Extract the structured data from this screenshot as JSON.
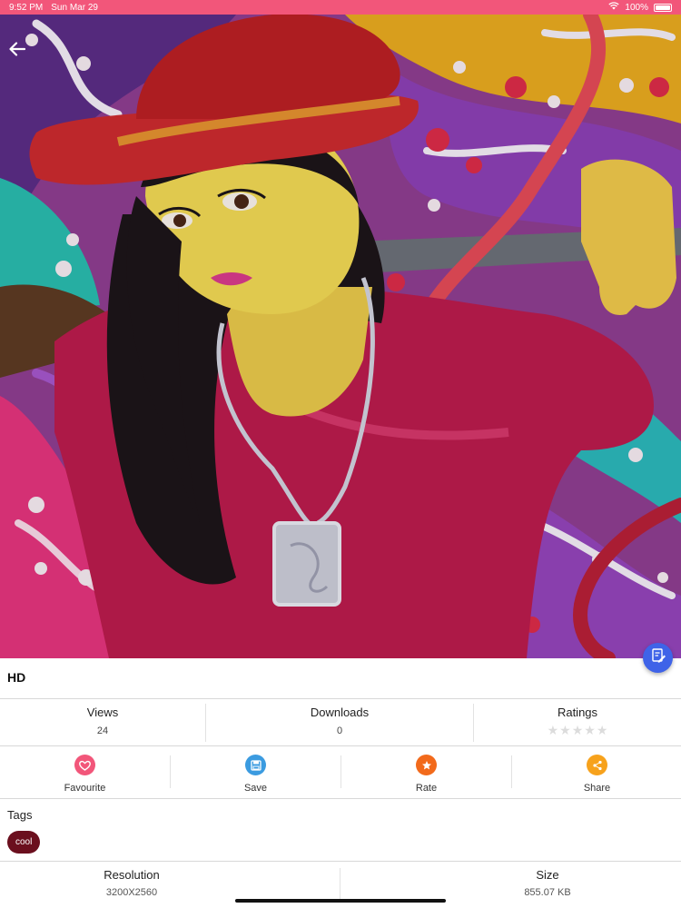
{
  "status_bar": {
    "time": "9:52 PM",
    "date": "Sun Mar 29",
    "battery": "100%",
    "icons": [
      "wifi-icon",
      "battery-icon"
    ]
  },
  "hero": {
    "icon": "back-arrow-icon",
    "fab_icon": "edit-document-icon",
    "fab_color": "#3f63e8"
  },
  "quality_label": "HD",
  "stats": {
    "views": {
      "label": "Views",
      "value": "24"
    },
    "downloads": {
      "label": "Downloads",
      "value": "0"
    },
    "ratings": {
      "label": "Ratings",
      "stars": 5,
      "filled": 0
    }
  },
  "actions": [
    {
      "label": "Favourite",
      "icon": "heart-icon",
      "color": "#f2567a"
    },
    {
      "label": "Save",
      "icon": "save-icon",
      "color": "#3b9be0"
    },
    {
      "label": "Rate",
      "icon": "star-icon",
      "color": "#f26a1b"
    },
    {
      "label": "Share",
      "icon": "share-icon",
      "color": "#f7a21c"
    }
  ],
  "tags": {
    "title": "Tags",
    "items": [
      "cool"
    ],
    "chip_color": "#6b0f1e"
  },
  "info": {
    "resolution": {
      "label": "Resolution",
      "value": "3200X2560"
    },
    "size": {
      "label": "Size",
      "value": "855.07 KB"
    }
  },
  "colors": {
    "accent": "#f2567a"
  }
}
